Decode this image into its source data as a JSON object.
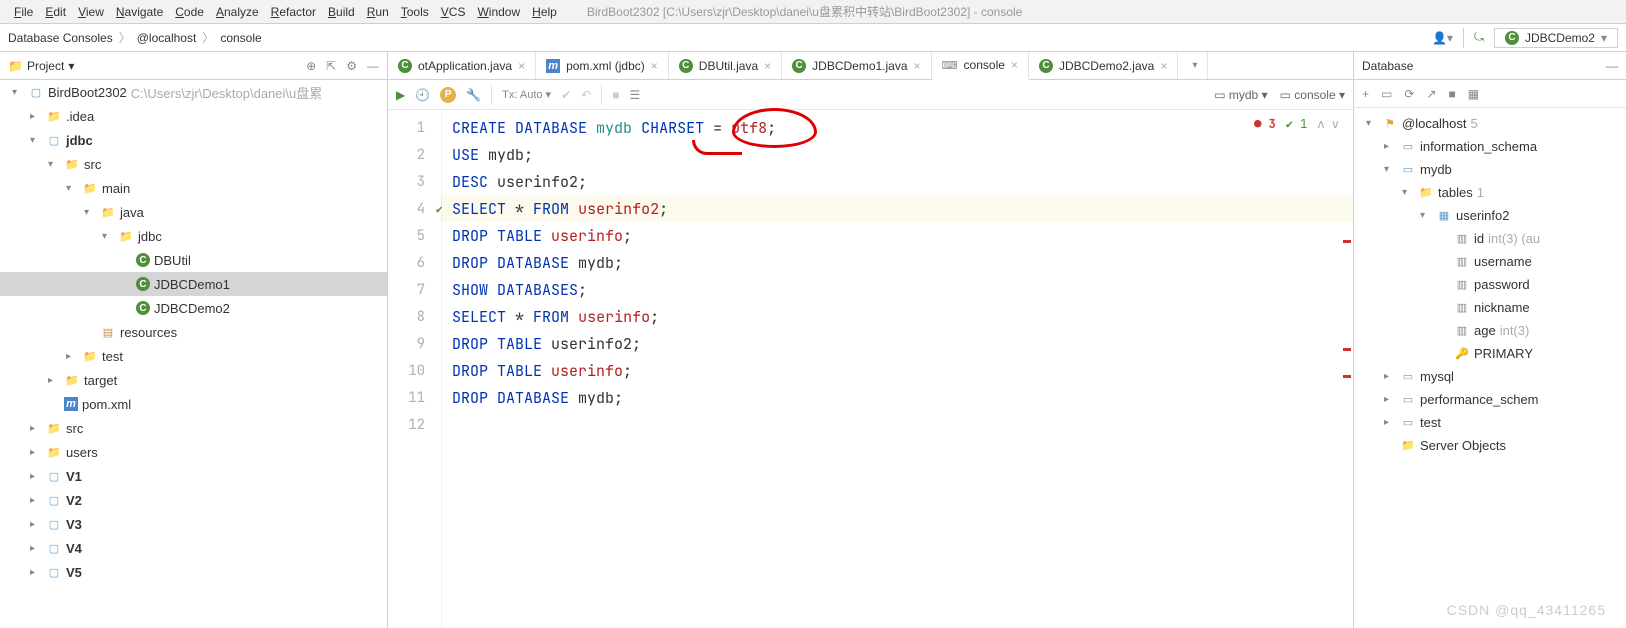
{
  "menu": [
    "File",
    "Edit",
    "View",
    "Navigate",
    "Code",
    "Analyze",
    "Refactor",
    "Build",
    "Run",
    "Tools",
    "VCS",
    "Window",
    "Help"
  ],
  "window_title": "BirdBoot2302 [C:\\Users\\zjr\\Desktop\\danei\\u盘累积中转站\\BirdBoot2302] - console",
  "breadcrumb": [
    "Database Consoles",
    "@localhost",
    "console"
  ],
  "run_config": "JDBCDemo2",
  "project_panel_title": "Project",
  "project_tree": [
    {
      "d": 0,
      "a": "▾",
      "i": "mod",
      "t": "BirdBoot2302",
      "s": " C:\\Users\\zjr\\Desktop\\danei\\u盘累"
    },
    {
      "d": 1,
      "a": "▸",
      "i": "f",
      "t": ".idea"
    },
    {
      "d": 1,
      "a": "▾",
      "i": "mod",
      "t": "jdbc",
      "bold": true
    },
    {
      "d": 2,
      "a": "▾",
      "i": "src",
      "t": "src"
    },
    {
      "d": 3,
      "a": "▾",
      "i": "f",
      "t": "main"
    },
    {
      "d": 4,
      "a": "▾",
      "i": "src",
      "t": "java"
    },
    {
      "d": 5,
      "a": "▾",
      "i": "f",
      "t": "jdbc"
    },
    {
      "d": 6,
      "a": "",
      "i": "c",
      "t": "DBUtil"
    },
    {
      "d": 6,
      "a": "",
      "i": "c",
      "t": "JDBCDemo1",
      "sel": true
    },
    {
      "d": 6,
      "a": "",
      "i": "c",
      "t": "JDBCDemo2"
    },
    {
      "d": 4,
      "a": "",
      "i": "res",
      "t": "resources"
    },
    {
      "d": 3,
      "a": "▸",
      "i": "f",
      "t": "test"
    },
    {
      "d": 2,
      "a": "▸",
      "i": "fo",
      "t": "target"
    },
    {
      "d": 2,
      "a": "",
      "i": "m",
      "t": "pom.xml"
    },
    {
      "d": 1,
      "a": "▸",
      "i": "f",
      "t": "src"
    },
    {
      "d": 1,
      "a": "▸",
      "i": "f",
      "t": "users"
    },
    {
      "d": 1,
      "a": "▸",
      "i": "mod",
      "t": "V1",
      "bold": true
    },
    {
      "d": 1,
      "a": "▸",
      "i": "mod",
      "t": "V2",
      "bold": true
    },
    {
      "d": 1,
      "a": "▸",
      "i": "mod",
      "t": "V3",
      "bold": true
    },
    {
      "d": 1,
      "a": "▸",
      "i": "mod",
      "t": "V4",
      "bold": true
    },
    {
      "d": 1,
      "a": "▸",
      "i": "mod",
      "t": "V5",
      "bold": true
    }
  ],
  "editor_tabs": [
    {
      "i": "c",
      "t": "otApplication.java",
      "clip": true
    },
    {
      "i": "m",
      "t": "pom.xml (jdbc)"
    },
    {
      "i": "c",
      "t": "DBUtil.java"
    },
    {
      "i": "c",
      "t": "JDBCDemo1.java"
    },
    {
      "i": "con",
      "t": "console",
      "active": true
    },
    {
      "i": "c",
      "t": "JDBCDemo2.java"
    }
  ],
  "tx_label": "Tx: Auto",
  "context_db": "mydb",
  "context_console": "console",
  "code_lines": [
    [
      {
        "c": "kw",
        "t": "CREATE DATABASE"
      },
      {
        "c": "plain",
        "t": " "
      },
      {
        "c": "id",
        "t": "mydb"
      },
      {
        "c": "plain",
        "t": " "
      },
      {
        "c": "kw",
        "t": "CHARSET"
      },
      {
        "c": "plain",
        "t": " = "
      },
      {
        "c": "err",
        "t": "utf8"
      },
      {
        "c": "plain",
        "t": ";"
      }
    ],
    [
      {
        "c": "kw",
        "t": "USE"
      },
      {
        "c": "plain",
        "t": " mydb;"
      }
    ],
    [
      {
        "c": "kw",
        "t": "DESC"
      },
      {
        "c": "plain",
        "t": " userinfo2;"
      }
    ],
    [
      {
        "c": "kw",
        "t": "SELECT"
      },
      {
        "c": "plain",
        "t": " * "
      },
      {
        "c": "kw",
        "t": "FROM"
      },
      {
        "c": "plain",
        "t": " "
      },
      {
        "c": "err",
        "t": "userinfo2"
      },
      {
        "c": "plain",
        "t": ";"
      }
    ],
    [
      {
        "c": "kw",
        "t": "DROP TABLE"
      },
      {
        "c": "plain",
        "t": " "
      },
      {
        "c": "err",
        "t": "userinfo"
      },
      {
        "c": "plain",
        "t": ";"
      }
    ],
    [
      {
        "c": "kw",
        "t": "DROP DATABASE"
      },
      {
        "c": "plain",
        "t": " mydb;"
      }
    ],
    [
      {
        "c": "kw",
        "t": "SHOW DATABASES"
      },
      {
        "c": "plain",
        "t": ";"
      }
    ],
    [
      {
        "c": "kw",
        "t": "SELECT"
      },
      {
        "c": "plain",
        "t": " * "
      },
      {
        "c": "kw",
        "t": "FROM"
      },
      {
        "c": "plain",
        "t": " "
      },
      {
        "c": "err",
        "t": "userinfo"
      },
      {
        "c": "plain",
        "t": ";"
      }
    ],
    [
      {
        "c": "kw",
        "t": "DROP TABLE"
      },
      {
        "c": "plain",
        "t": " userinfo2;"
      }
    ],
    [
      {
        "c": "kw",
        "t": "DROP TABLE"
      },
      {
        "c": "plain",
        "t": " "
      },
      {
        "c": "err",
        "t": "userinfo"
      },
      {
        "c": "plain",
        "t": ";"
      }
    ],
    [
      {
        "c": "kw",
        "t": "DROP DATABASE"
      },
      {
        "c": "plain",
        "t": " mydb;"
      }
    ],
    []
  ],
  "highlighted_line": 4,
  "gutter_ok_line": 4,
  "error_count": "3",
  "warn_count": "1",
  "db_panel_title": "Database",
  "db_tree": [
    {
      "d": 0,
      "a": "▾",
      "i": "ds",
      "t": "@localhost",
      "s": " 5"
    },
    {
      "d": 1,
      "a": "▸",
      "i": "db",
      "t": "information_schema"
    },
    {
      "d": 1,
      "a": "▾",
      "i": "db",
      "t": "mydb"
    },
    {
      "d": 2,
      "a": "▾",
      "i": "f",
      "t": "tables",
      "s": " 1"
    },
    {
      "d": 3,
      "a": "▾",
      "i": "tbl",
      "t": "userinfo2"
    },
    {
      "d": 4,
      "a": "",
      "i": "col",
      "t": "id",
      "s": " int(3) (au"
    },
    {
      "d": 4,
      "a": "",
      "i": "col",
      "t": "username"
    },
    {
      "d": 4,
      "a": "",
      "i": "col",
      "t": "password"
    },
    {
      "d": 4,
      "a": "",
      "i": "col",
      "t": "nickname"
    },
    {
      "d": 4,
      "a": "",
      "i": "col",
      "t": "age",
      "s": " int(3)"
    },
    {
      "d": 4,
      "a": "",
      "i": "key",
      "t": "PRIMARY"
    },
    {
      "d": 1,
      "a": "▸",
      "i": "db",
      "t": "mysql"
    },
    {
      "d": 1,
      "a": "▸",
      "i": "db",
      "t": "performance_schem"
    },
    {
      "d": 1,
      "a": "▸",
      "i": "db",
      "t": "test"
    },
    {
      "d": 1,
      "a": "",
      "i": "f",
      "t": "Server Objects"
    }
  ],
  "watermark": "CSDN @qq_43411265"
}
